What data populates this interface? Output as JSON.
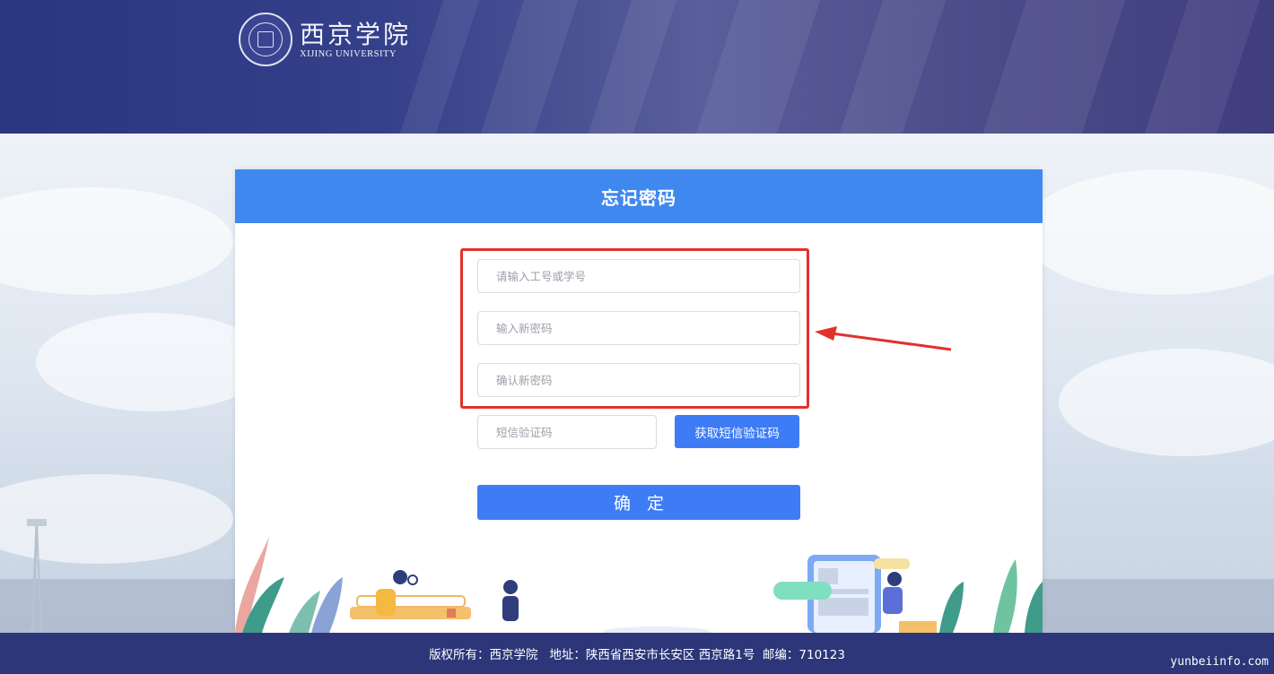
{
  "header": {
    "logo_cn": "西京学院",
    "logo_en": "XIJING UNIVERSITY"
  },
  "form": {
    "title": "忘记密码",
    "account_placeholder": "请输入工号或学号",
    "new_password_placeholder": "输入新密码",
    "confirm_password_placeholder": "确认新密码",
    "sms_code_placeholder": "短信验证码",
    "sms_button_label": "获取短信验证码",
    "confirm_button_label": "确定"
  },
  "footer": {
    "text": "版权所有：西京学院   地址：陕西省西安市长安区 西京路1号  邮编：710123"
  },
  "watermark": "yunbeiinfo.com",
  "colors": {
    "header_bg": "#2b3680",
    "card_header_bg": "#3f88f0",
    "button_bg": "#3d7cf5",
    "highlight_red": "#e1312b",
    "footer_bg": "#2c3679"
  },
  "icons": [
    "university-seal-icon",
    "annotation-arrow-icon"
  ]
}
